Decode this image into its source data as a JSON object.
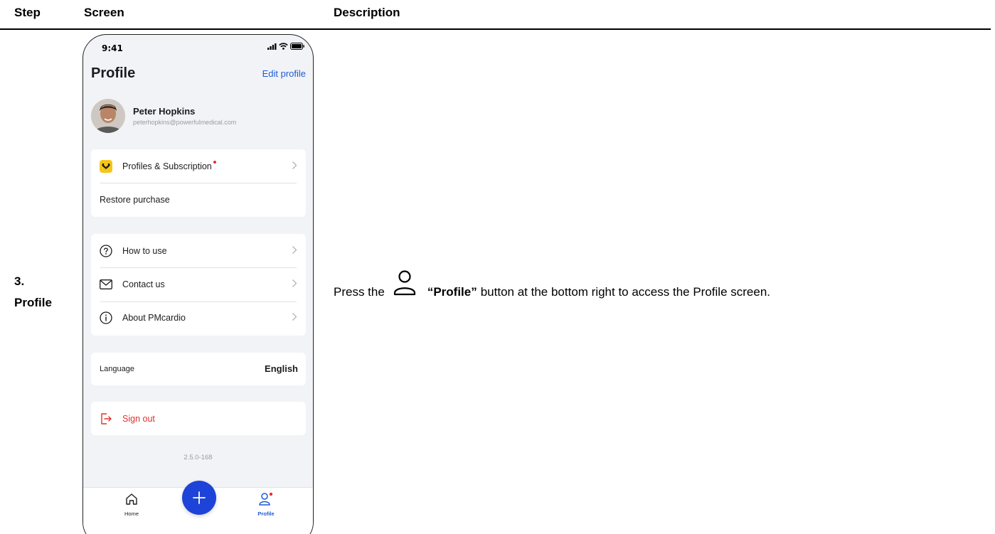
{
  "table": {
    "headers": {
      "step": "Step",
      "screen": "Screen",
      "description": "Description"
    },
    "row": {
      "step_number": "3.",
      "step_name": "Profile",
      "description": {
        "before": "Press the",
        "button_name": "“Profile”",
        "after": "button at the bottom right to access the Profile screen.",
        "icon": "person-outline-icon"
      }
    }
  },
  "phone": {
    "status_bar": {
      "time": "9:41"
    },
    "header": {
      "title": "Profile",
      "edit_link": "Edit profile"
    },
    "user": {
      "name": "Peter Hopkins",
      "email": "peterhopkins@powerfulmedical.com"
    },
    "subscription_card": {
      "items": [
        {
          "label": "Profiles & Subscription",
          "icon": "brand-logo-icon",
          "has_notification_dot": true
        },
        {
          "label": "Restore purchase"
        }
      ]
    },
    "help_card": {
      "items": [
        {
          "label": "How to use",
          "icon": "question-circle-icon"
        },
        {
          "label": "Contact us",
          "icon": "mail-icon"
        },
        {
          "label": "About PMcardio",
          "icon": "info-circle-icon"
        }
      ]
    },
    "language": {
      "label": "Language",
      "value": "English"
    },
    "sign_out": {
      "label": "Sign out",
      "icon": "sign-out-icon"
    },
    "version": "2.5.0-168",
    "tab_bar": {
      "home_label": "Home",
      "profile_label": "Profile",
      "fab_icon": "plus-icon"
    }
  },
  "colors": {
    "accent_blue": "#1f5ad6",
    "fab_blue": "#1e43d8",
    "danger_red": "#e5302b",
    "brand_yellow": "#f5c518",
    "screen_bg": "#f2f3f7"
  }
}
